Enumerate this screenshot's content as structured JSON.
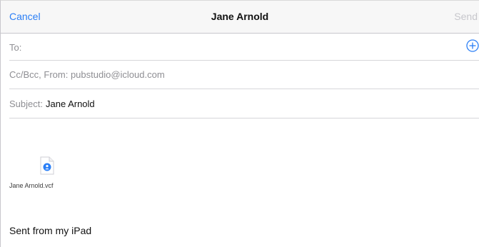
{
  "navbar": {
    "cancel_label": "Cancel",
    "title": "Jane Arnold",
    "send_label": "Send"
  },
  "fields": {
    "to_label": "To:",
    "cc_label": "Cc/Bcc, From: pubstudio@icloud.com",
    "subject_label": "Subject:",
    "subject_value": "Jane Arnold"
  },
  "attachment": {
    "filename": "Jane Arnold.vcf",
    "icon": "contact-card-icon"
  },
  "body": {
    "signature": "Sent from my iPad"
  },
  "colors": {
    "accent": "#2b7ff6",
    "disabled": "#c7c7cc",
    "label_gray": "#8e8e93"
  }
}
